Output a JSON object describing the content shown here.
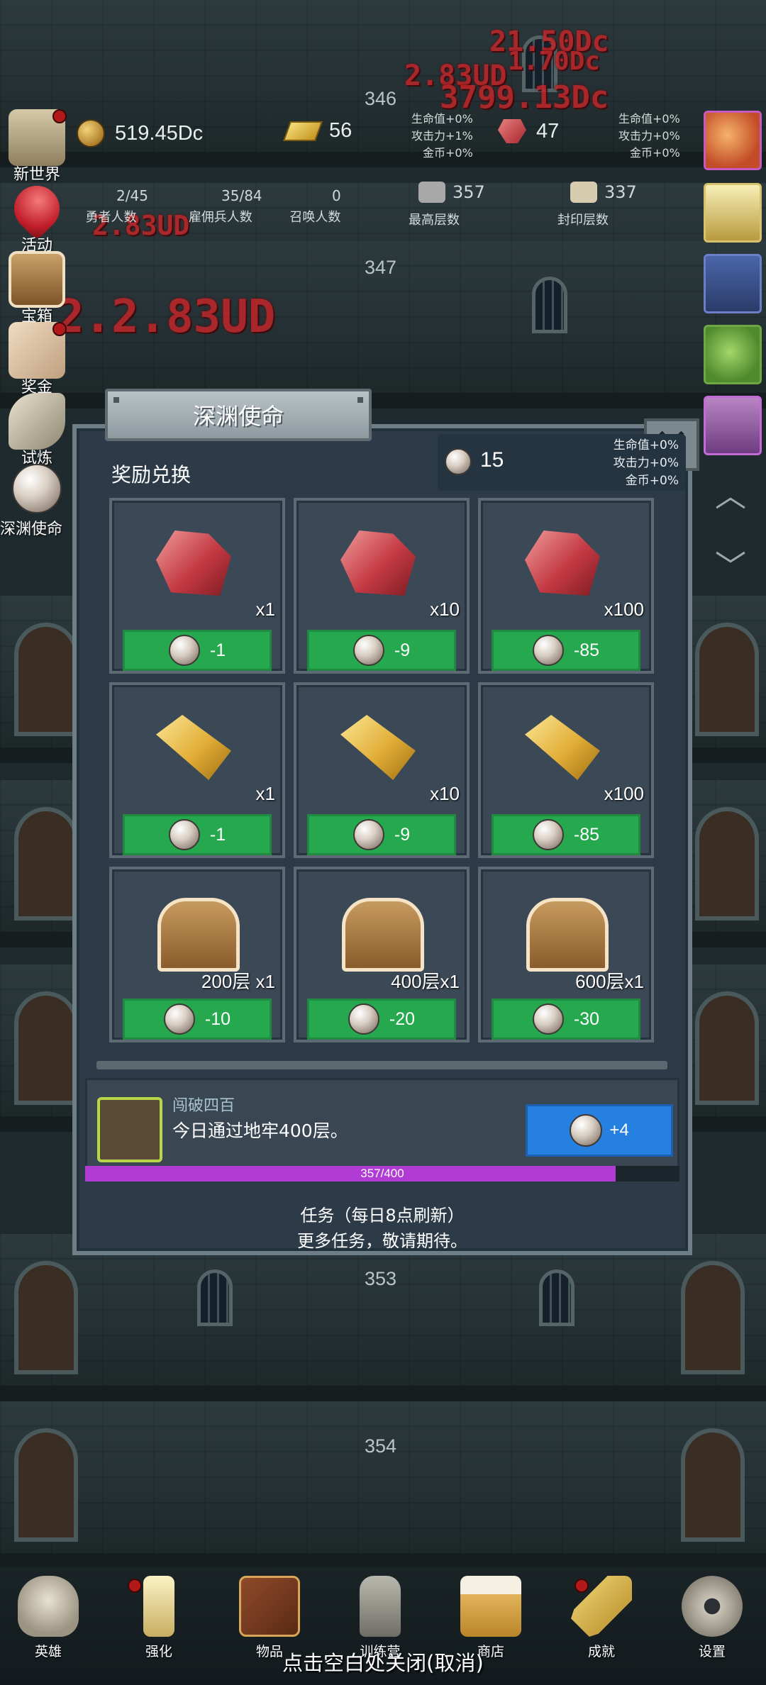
{
  "hud": {
    "gold": "519.45Dc",
    "bars": "56",
    "gems": "47",
    "floor_top": "346",
    "left_bonus": {
      "hp": "生命值+0%",
      "atk": "攻击力+1%",
      "coin": "金币+0%"
    },
    "right_bonus": {
      "hp": "生命值+0%",
      "atk": "攻击力+0%",
      "coin": "金币+0%"
    },
    "heroes": {
      "value": "2/45",
      "label": "勇者人数"
    },
    "mercs": {
      "value": "35/84",
      "label": "雇佣兵人数"
    },
    "summons": {
      "value": "0",
      "label": "召唤人数"
    },
    "max_floor": {
      "value": "357",
      "label": "最高层数"
    },
    "seal_floor": {
      "value": "337",
      "label": "封印层数"
    }
  },
  "damage_texts": [
    "21.50Dc",
    "1.70Dc",
    "2.83UD",
    "3799.13Dc",
    "2.83UD",
    "2.2.83UD"
  ],
  "floors": [
    "347",
    "353",
    "354"
  ],
  "side_left": [
    {
      "label": "新世界",
      "icon": "new-world-icon",
      "dot": true
    },
    {
      "label": "活动",
      "icon": "heart-icon",
      "dot": false
    },
    {
      "label": "宝箱",
      "icon": "chest-icon",
      "dot": false
    },
    {
      "label": "奖金",
      "icon": "envelope-icon",
      "dot": true
    },
    {
      "label": "试炼",
      "icon": "feather-icon",
      "dot": false
    },
    {
      "label": "深渊使命",
      "icon": "pearl-icon",
      "dot": false
    }
  ],
  "modal": {
    "title": "深渊使命",
    "section": "奖励兑换",
    "pearl_count": "15",
    "bonus": {
      "hp": "生命值+0%",
      "atk": "攻击力+0%",
      "coin": "金币+0%"
    },
    "items": [
      {
        "art": "ruby",
        "qty": "x1",
        "cost": "-1"
      },
      {
        "art": "ruby",
        "qty": "x10",
        "cost": "-9"
      },
      {
        "art": "ruby",
        "qty": "x100",
        "cost": "-85"
      },
      {
        "art": "gold",
        "qty": "x1",
        "cost": "-1"
      },
      {
        "art": "gold",
        "qty": "x10",
        "cost": "-9"
      },
      {
        "art": "gold",
        "qty": "x100",
        "cost": "-85"
      },
      {
        "art": "chest",
        "qty": "200层 x1",
        "cost": "-10"
      },
      {
        "art": "chest",
        "qty": "400层x1",
        "cost": "-20"
      },
      {
        "art": "chest",
        "qty": "600层x1",
        "cost": "-30"
      }
    ],
    "task": {
      "title": "闯破四百",
      "desc": "今日通过地牢400层。",
      "reward": "+4",
      "progress_text": "357/400",
      "progress": 0.8925
    },
    "footer1": "任务（每日8点刷新）",
    "footer2": "更多任务，敬请期待。"
  },
  "nav": [
    {
      "label": "英雄",
      "icon": "skull-icon",
      "dot": false
    },
    {
      "label": "强化",
      "icon": "candle-icon",
      "dot": true
    },
    {
      "label": "物品",
      "icon": "book-icon",
      "dot": false
    },
    {
      "label": "训练营",
      "icon": "lantern-icon",
      "dot": false
    },
    {
      "label": "商店",
      "icon": "beer-mug-icon",
      "dot": false
    },
    {
      "label": "成就",
      "icon": "key-icon",
      "dot": true
    },
    {
      "label": "设置",
      "icon": "gear-icon",
      "dot": false
    }
  ],
  "close_hint": "点击空白处关闭(取消)",
  "colors": {
    "green_btn": "#26a84f",
    "blue_btn": "#2680e0",
    "progress": "#b13cd4",
    "modal_bg": "#2d3b48"
  }
}
